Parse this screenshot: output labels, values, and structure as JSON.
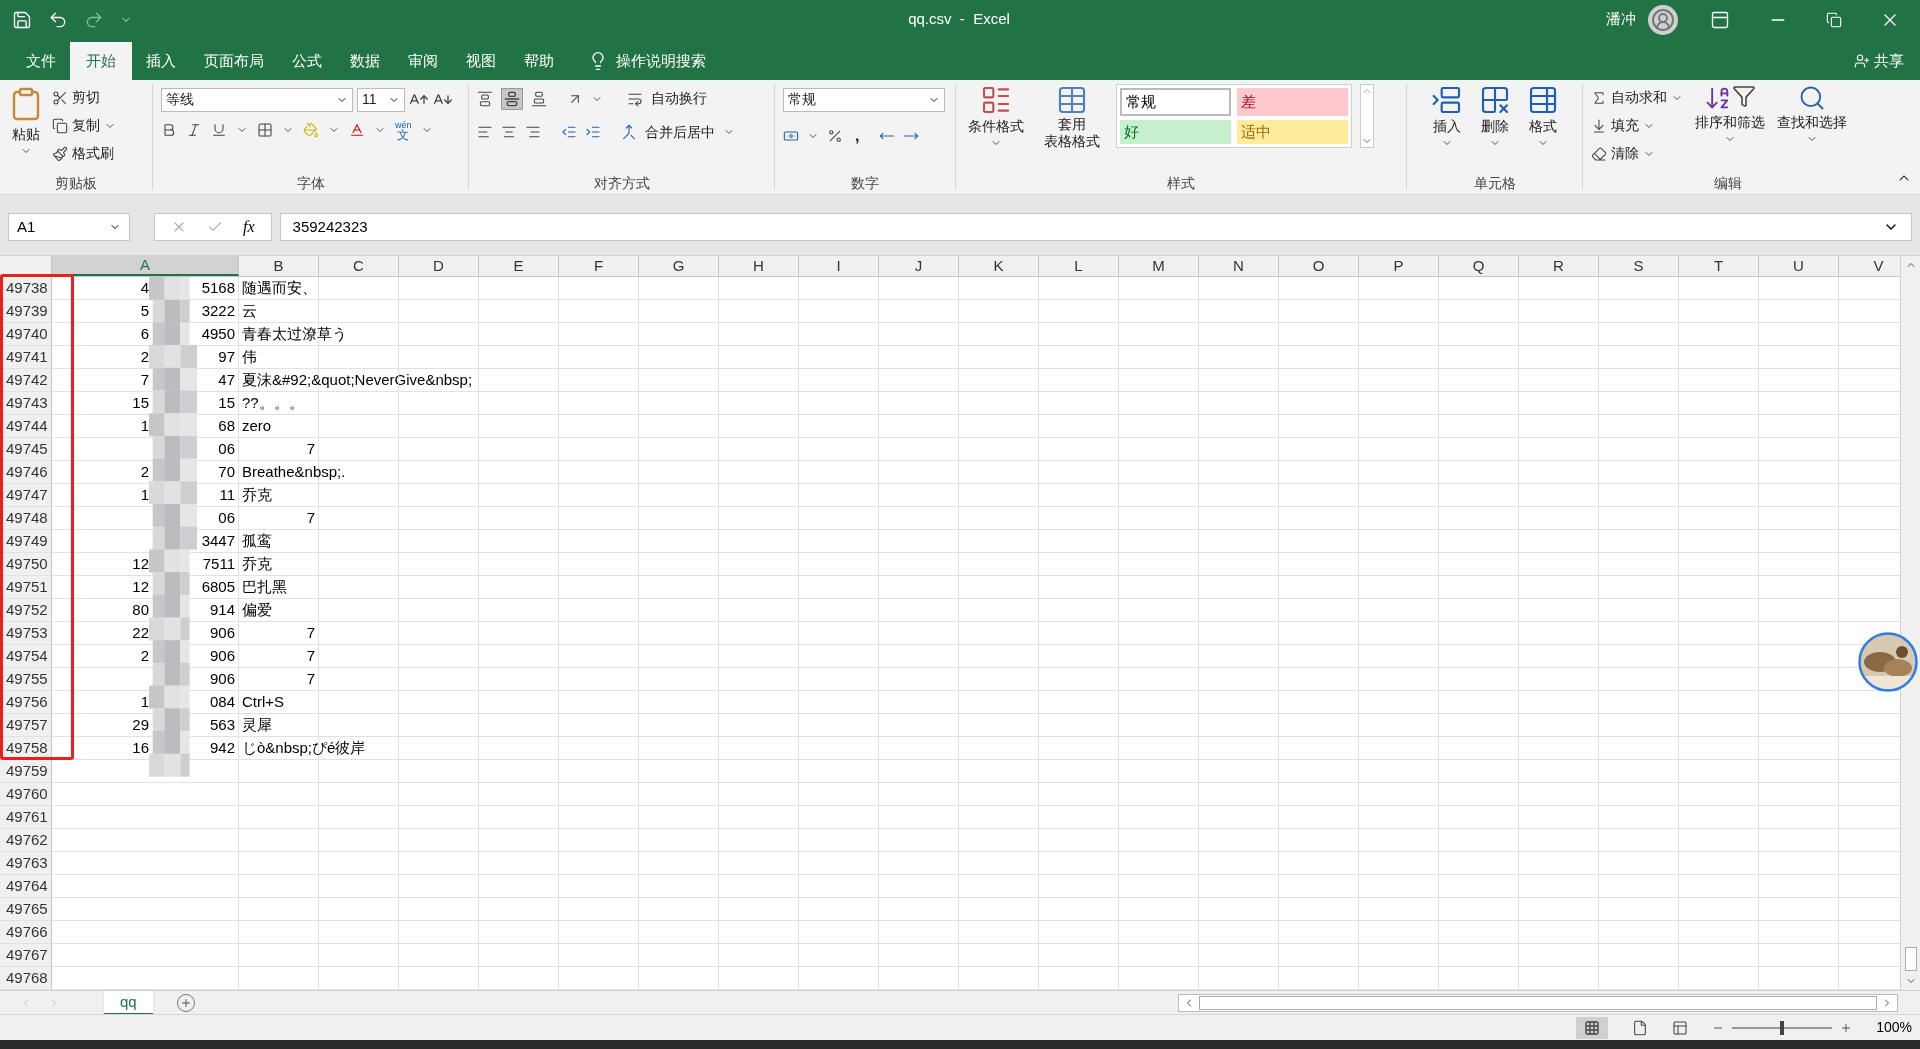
{
  "title_bar": {
    "title": "qq.csv  -  Excel",
    "user": "潘冲"
  },
  "tabs": [
    {
      "label": "文件",
      "selected": false
    },
    {
      "label": "开始",
      "selected": true
    },
    {
      "label": "插入",
      "selected": false
    },
    {
      "label": "页面布局",
      "selected": false
    },
    {
      "label": "公式",
      "selected": false
    },
    {
      "label": "数据",
      "selected": false
    },
    {
      "label": "审阅",
      "selected": false
    },
    {
      "label": "视图",
      "selected": false
    },
    {
      "label": "帮助",
      "selected": false
    }
  ],
  "tell_me": "操作说明搜索",
  "share": "共享",
  "ribbon": {
    "clipboard": {
      "paste": "粘贴",
      "cut": "剪切",
      "copy": "复制",
      "format_painter": "格式刷",
      "label": "剪贴板"
    },
    "font": {
      "name": "等线",
      "size": "11",
      "phonetic": "wén",
      "phonetic_char": "文",
      "label": "字体"
    },
    "alignment": {
      "wrap": "自动换行",
      "merge": "合并后居中",
      "label": "对齐方式"
    },
    "number": {
      "format": "常规",
      "comma": ",",
      "label": "数字"
    },
    "styles": {
      "conditional": "条件格式",
      "table_format": [
        "套用",
        "表格格式"
      ],
      "label": "样式",
      "cell_styles": [
        {
          "label": "常规",
          "color": "#ffffff",
          "selected": true
        },
        {
          "label": "差",
          "color": "#ffc7ce",
          "selected": false
        },
        {
          "label": "好",
          "color": "#c6efce",
          "selected": false
        },
        {
          "label": "适中",
          "color": "#ffeb9c",
          "selected": false
        }
      ]
    },
    "cells": {
      "buttons": [
        "插入",
        "删除",
        "格式"
      ],
      "label": "单元格"
    },
    "editing": {
      "autosum": "自动求和",
      "fill": "填充",
      "clear": "清除",
      "sort": "排序和筛选",
      "find": "查找和选择",
      "label": "编辑"
    }
  },
  "formula_bar": {
    "name_box": "A1",
    "function_label": "fx",
    "value": "359242323"
  },
  "columns": [
    {
      "label": "A",
      "selected": true
    },
    {
      "label": "B",
      "selected": false
    },
    {
      "label": "C",
      "selected": false
    },
    {
      "label": "D",
      "selected": false
    },
    {
      "label": "E",
      "selected": false
    },
    {
      "label": "F",
      "selected": false
    },
    {
      "label": "G",
      "selected": false
    },
    {
      "label": "H",
      "selected": false
    },
    {
      "label": "I",
      "selected": false
    },
    {
      "label": "J",
      "selected": false
    },
    {
      "label": "K",
      "selected": false
    },
    {
      "label": "L",
      "selected": false
    },
    {
      "label": "M",
      "selected": false
    },
    {
      "label": "N",
      "selected": false
    },
    {
      "label": "O",
      "selected": false
    },
    {
      "label": "P",
      "selected": false
    },
    {
      "label": "Q",
      "selected": false
    },
    {
      "label": "R",
      "selected": false
    },
    {
      "label": "S",
      "selected": false
    },
    {
      "label": "T",
      "selected": false
    },
    {
      "label": "U",
      "selected": false
    },
    {
      "label": "V",
      "selected": false
    }
  ],
  "rows": [
    {
      "number": "49738",
      "a_start": "4",
      "a_end": "5168",
      "b": {
        "text": "随遇而安、",
        "kind": "text"
      }
    },
    {
      "number": "49739",
      "a_start": "5",
      "a_end": "3222",
      "b": {
        "text": "云",
        "kind": "text"
      }
    },
    {
      "number": "49740",
      "a_start": "6",
      "a_end": "4950",
      "b": {
        "text": "青春太过潦草う",
        "kind": "text"
      }
    },
    {
      "number": "49741",
      "a_start": "2",
      "a_end": "97",
      "b": {
        "text": "伟",
        "kind": "text"
      }
    },
    {
      "number": "49742",
      "a_start": "7",
      "a_end": "47",
      "b": {
        "text": "夏沫&#92;&quot;NeverGive&nbsp;",
        "kind": "text"
      }
    },
    {
      "number": "49743",
      "a_start": "15",
      "a_end": "15",
      "b": {
        "text": "??。。。",
        "kind": "text"
      }
    },
    {
      "number": "49744",
      "a_start": "1",
      "a_end": "68",
      "b": {
        "text": "zero",
        "kind": "text"
      }
    },
    {
      "number": "49745",
      "a_end": "06",
      "b": {
        "text": "7",
        "kind": "number"
      }
    },
    {
      "number": "49746",
      "a_start": "2",
      "a_end": "70",
      "b": {
        "text": "Breathe&nbsp;.",
        "kind": "text"
      }
    },
    {
      "number": "49747",
      "a_start": "1",
      "a_end": "11",
      "b": {
        "text": "乔克",
        "kind": "text"
      }
    },
    {
      "number": "49748",
      "a_end": "06",
      "b": {
        "text": "7",
        "kind": "number"
      }
    },
    {
      "number": "49749",
      "a_end": "3447",
      "b": {
        "text": "孤鸾",
        "kind": "text"
      }
    },
    {
      "number": "49750",
      "a_start": "12",
      "a_end": "7511",
      "b": {
        "text": "乔克",
        "kind": "text"
      }
    },
    {
      "number": "49751",
      "a_start": "12",
      "a_end": "6805",
      "b": {
        "text": "巴扎黑",
        "kind": "text"
      }
    },
    {
      "number": "49752",
      "a_start": "80",
      "a_end": "914",
      "b": {
        "text": "偏爱",
        "kind": "text"
      }
    },
    {
      "number": "49753",
      "a_start": "22",
      "a_end": "906",
      "b": {
        "text": "7",
        "kind": "number"
      }
    },
    {
      "number": "49754",
      "a_start": "2",
      "a_end": "906",
      "b": {
        "text": "7",
        "kind": "number"
      }
    },
    {
      "number": "49755",
      "a_end": "906",
      "b": {
        "text": "7",
        "kind": "number"
      }
    },
    {
      "number": "49756",
      "a_start": "1",
      "a_end": "084",
      "b": {
        "text": "Ctrl+S",
        "kind": "text"
      }
    },
    {
      "number": "49757",
      "a_start": "29",
      "a_end": "563",
      "b": {
        "text": "灵犀",
        "kind": "text"
      }
    },
    {
      "number": "49758",
      "a_start": "16",
      "a_end": "942",
      "b": {
        "text": "じò&nbsp;ぴé彼岸",
        "kind": "text"
      }
    },
    {
      "number": "49759"
    },
    {
      "number": "49760"
    },
    {
      "number": "49761"
    },
    {
      "number": "49762"
    },
    {
      "number": "49763"
    },
    {
      "number": "49764"
    },
    {
      "number": "49765"
    },
    {
      "number": "49766"
    },
    {
      "number": "49767"
    },
    {
      "number": "49768"
    }
  ],
  "sheet_tabs": [
    {
      "label": "qq",
      "selected": true
    }
  ],
  "status_bar": {
    "zoom": "100%",
    "zoom_slider": {
      "level": 0.5
    }
  }
}
